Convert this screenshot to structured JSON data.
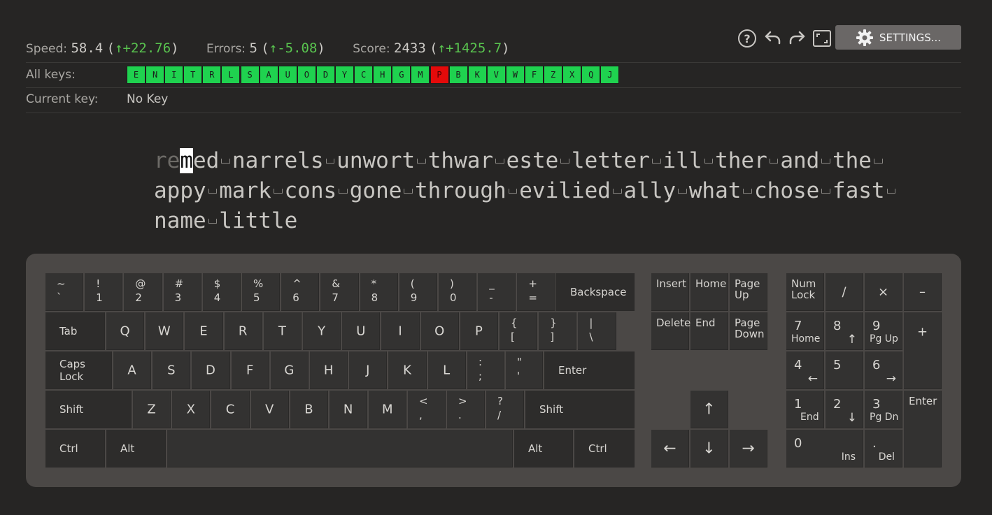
{
  "stats": {
    "speed": {
      "label": "Speed:",
      "value": "58.4",
      "open": "(",
      "delta": "↑+22.76",
      "close": ")"
    },
    "errors": {
      "label": "Errors:",
      "value": "5",
      "open": "(",
      "delta": "↑-5.08",
      "close": ")"
    },
    "score": {
      "label": "Score:",
      "value": "2433",
      "open": "(",
      "delta": "↑+1425.7",
      "close": ")"
    }
  },
  "toolbar": {
    "settings_label": "SETTINGS...",
    "icons": [
      "help-icon",
      "undo-icon",
      "redo-icon",
      "fullscreen-icon",
      "gear-icon"
    ]
  },
  "all_keys": {
    "label": "All keys:",
    "keys": [
      {
        "k": "E",
        "state": "good"
      },
      {
        "k": "N",
        "state": "good"
      },
      {
        "k": "I",
        "state": "good"
      },
      {
        "k": "T",
        "state": "good"
      },
      {
        "k": "R",
        "state": "good"
      },
      {
        "k": "L",
        "state": "good"
      },
      {
        "k": "S",
        "state": "good"
      },
      {
        "k": "A",
        "state": "good"
      },
      {
        "k": "U",
        "state": "good"
      },
      {
        "k": "O",
        "state": "good"
      },
      {
        "k": "D",
        "state": "good"
      },
      {
        "k": "Y",
        "state": "good"
      },
      {
        "k": "C",
        "state": "good"
      },
      {
        "k": "H",
        "state": "good"
      },
      {
        "k": "G",
        "state": "good"
      },
      {
        "k": "M",
        "state": "good"
      },
      {
        "k": "P",
        "state": "bad"
      },
      {
        "k": "B",
        "state": "good"
      },
      {
        "k": "K",
        "state": "good"
      },
      {
        "k": "V",
        "state": "good"
      },
      {
        "k": "W",
        "state": "good"
      },
      {
        "k": "F",
        "state": "good"
      },
      {
        "k": "Z",
        "state": "good"
      },
      {
        "k": "X",
        "state": "good"
      },
      {
        "k": "Q",
        "state": "good"
      },
      {
        "k": "J",
        "state": "good"
      }
    ],
    "colors": {
      "good": "#1fd24f",
      "bad": "#e40a0a"
    }
  },
  "current_key": {
    "label": "Current key:",
    "value": "No Key"
  },
  "practice_text": {
    "typed": "re",
    "cursor": "m",
    "line1_rest": "ed narrels unwort thwar este letter ill ther and the ",
    "line2": "appy mark cons gone through evilied ally what chose fast ",
    "line3": "name little"
  },
  "keyboard": {
    "main": {
      "row1": [
        {
          "t": "~",
          "b": "`"
        },
        {
          "t": "!",
          "b": "1"
        },
        {
          "t": "@",
          "b": "2"
        },
        {
          "t": "#",
          "b": "3"
        },
        {
          "t": "$",
          "b": "4"
        },
        {
          "t": "%",
          "b": "5"
        },
        {
          "t": "^",
          "b": "6"
        },
        {
          "t": "&",
          "b": "7"
        },
        {
          "t": "*",
          "b": "8"
        },
        {
          "t": "(",
          "b": "9"
        },
        {
          "t": ")",
          "b": "0"
        },
        {
          "t": "_",
          "b": "-"
        },
        {
          "t": "+",
          "b": "="
        }
      ],
      "backspace": "Backspace",
      "tab": "Tab",
      "row2": [
        "Q",
        "W",
        "E",
        "R",
        "T",
        "Y",
        "U",
        "I",
        "O",
        "P"
      ],
      "row2_sym": [
        {
          "t": "{",
          "b": "["
        },
        {
          "t": "}",
          "b": "]"
        },
        {
          "t": "|",
          "b": "\\"
        }
      ],
      "caps": "Caps Lock",
      "row3": [
        "A",
        "S",
        "D",
        "F",
        "G",
        "H",
        "J",
        "K",
        "L"
      ],
      "row3_sym": [
        {
          "t": ":",
          "b": ";"
        },
        {
          "t": "\"",
          "b": "'"
        }
      ],
      "enter": "Enter",
      "shift_l": "Shift",
      "row4": [
        "Z",
        "X",
        "C",
        "V",
        "B",
        "N",
        "M"
      ],
      "row4_sym": [
        {
          "t": "<",
          "b": ","
        },
        {
          "t": ">",
          "b": "."
        },
        {
          "t": "?",
          "b": "/"
        }
      ],
      "shift_r": "Shift",
      "ctrl_l": "Ctrl",
      "alt_l": "Alt",
      "alt_r": "Alt",
      "ctrl_r": "Ctrl"
    },
    "nav": {
      "insert": "Insert",
      "home": "Home",
      "page_up": "Page Up",
      "delete": "Delete",
      "end": "End",
      "page_down": "Page Down",
      "up": "↑",
      "left": "←",
      "down": "↓",
      "right": "→"
    },
    "numpad": {
      "numlock": "Num Lock",
      "div": "/",
      "mul": "×",
      "minus": "–",
      "plus": "+",
      "enter": "Enter",
      "n7": "7",
      "n7s": "Home",
      "n8": "8",
      "n8s": "↑",
      "n9": "9",
      "n9s": "Pg Up",
      "n4": "4",
      "n4s": "←",
      "n5": "5",
      "n6": "6",
      "n6s": "→",
      "n1": "1",
      "n1s": "End",
      "n2": "2",
      "n2s": "↓",
      "n3": "3",
      "n3s": "Pg Dn",
      "n0": "0",
      "n0s": "Ins",
      "dot": ".",
      "dots": "Del"
    }
  }
}
